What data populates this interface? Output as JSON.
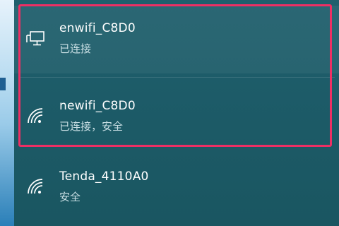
{
  "networks": [
    {
      "name": "enwifi_C8D0",
      "status": "已连接",
      "icon": "wired-monitor-icon"
    },
    {
      "name": "newifi_C8D0",
      "status": "已连接，安全",
      "icon": "wifi-signal-icon"
    },
    {
      "name": "Tenda_4110A0",
      "status": "安全",
      "icon": "wifi-signal-icon"
    }
  ],
  "colors": {
    "panel_bg": "#1f5f6d",
    "highlight_border": "#ee2f64",
    "text_primary": "#ffffff",
    "text_secondary": "#c9dfe4"
  }
}
